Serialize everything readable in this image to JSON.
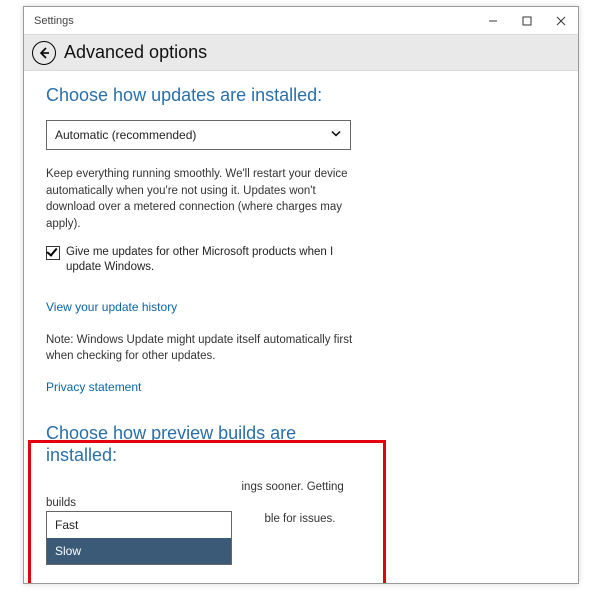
{
  "window": {
    "title": "Settings"
  },
  "header": {
    "page_title": "Advanced options"
  },
  "updates": {
    "heading": "Choose how updates are installed:",
    "dropdown_value": "Automatic (recommended)",
    "description": "Keep everything running smoothly. We'll restart your device automatically when you're not using it. Updates won't download over a metered connection (where charges may apply).",
    "checkbox_label": "Give me updates for other Microsoft products when I update Windows.",
    "history_link": "View your update history",
    "note": "Note: Windows Update might update itself automatically first when checking for other updates.",
    "privacy_link": "Privacy statement"
  },
  "preview": {
    "heading": "Choose how preview builds are installed:",
    "note_tail_1": "ings sooner. Getting builds",
    "note_tail_2": "ble for issues.",
    "options": {
      "0": "Fast",
      "1": "Slow"
    }
  }
}
